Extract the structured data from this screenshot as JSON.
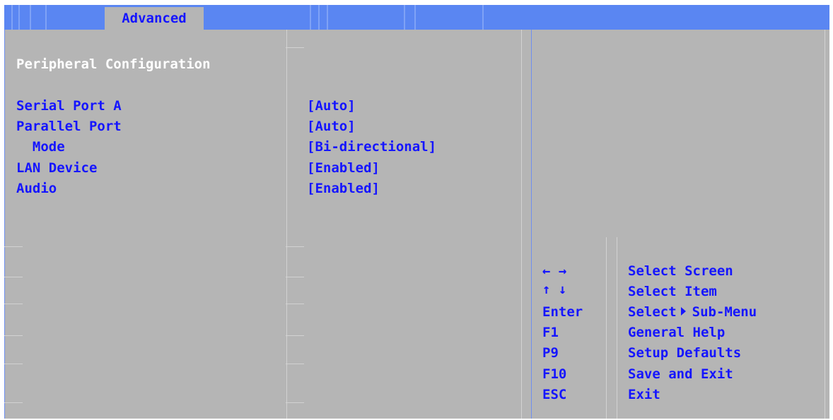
{
  "menubar": {
    "active_tab": "Advanced"
  },
  "section": {
    "title": "Peripheral Configuration"
  },
  "settings": [
    {
      "label": "Serial Port A",
      "value": "[Auto]"
    },
    {
      "label": "Parallel Port",
      "value": "[Auto]"
    },
    {
      "label": "  Mode",
      "value": "[Bi-directional]"
    },
    {
      "label": "LAN Device",
      "value": "[Enabled]"
    },
    {
      "label": "Audio",
      "value": "[Enabled]"
    }
  ],
  "help": [
    {
      "key": "← →",
      "desc": "Select Screen"
    },
    {
      "key": "↑ ↓",
      "desc": "Select Item"
    },
    {
      "key": "Enter",
      "desc_before": "Select",
      "desc_after": "Sub-Menu"
    },
    {
      "key": "F1",
      "desc": "General Help"
    },
    {
      "key": "P9",
      "desc": "Setup Defaults"
    },
    {
      "key": "F10",
      "desc": "Save and Exit"
    },
    {
      "key": "ESC",
      "desc": "Exit"
    }
  ],
  "icons": {
    "submenu_arrow": "triangle-right-icon"
  },
  "colors": {
    "menubar": "#5a86f2",
    "panel": "#b5b5b5",
    "text": "#1515ff",
    "title": "#ffffff"
  }
}
